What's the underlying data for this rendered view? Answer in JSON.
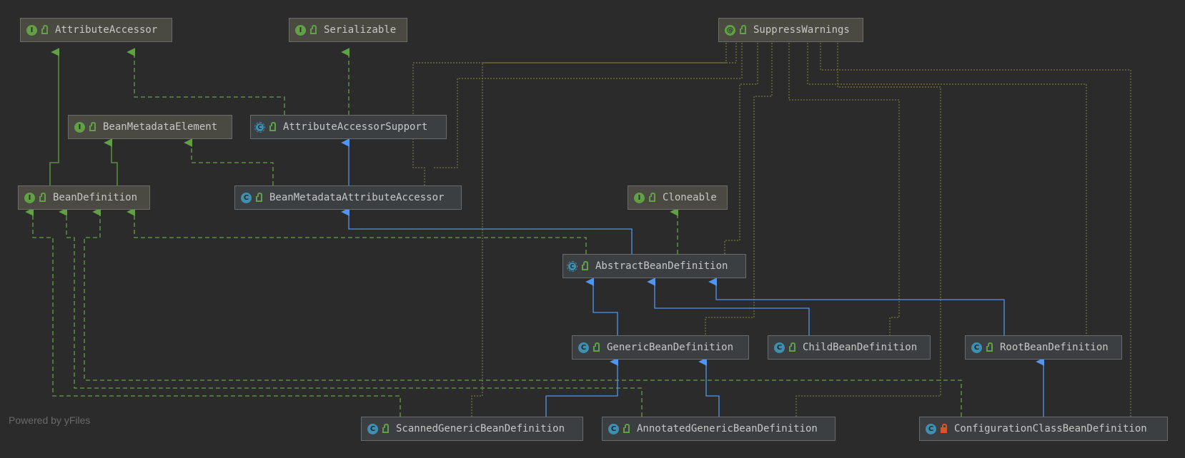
{
  "nodes": {
    "attribute_accessor": {
      "name": "AttributeAccessor",
      "kind": "interface",
      "badge": "I"
    },
    "serializable": {
      "name": "Serializable",
      "kind": "interface",
      "badge": "I"
    },
    "suppress_warnings": {
      "name": "SuppressWarnings",
      "kind": "annotation",
      "badge": "@"
    },
    "bean_metadata_element": {
      "name": "BeanMetadataElement",
      "kind": "interface",
      "badge": "I"
    },
    "attribute_accessor_support": {
      "name": "AttributeAccessorSupport",
      "kind": "abstract-class",
      "badge": "C"
    },
    "bean_definition": {
      "name": "BeanDefinition",
      "kind": "interface",
      "badge": "I"
    },
    "bean_metadata_attribute_accessor": {
      "name": "BeanMetadataAttributeAccessor",
      "kind": "class",
      "badge": "C"
    },
    "cloneable": {
      "name": "Cloneable",
      "kind": "interface",
      "badge": "I"
    },
    "abstract_bean_definition": {
      "name": "AbstractBeanDefinition",
      "kind": "abstract-class",
      "badge": "C"
    },
    "generic_bean_definition": {
      "name": "GenericBeanDefinition",
      "kind": "class",
      "badge": "C"
    },
    "child_bean_definition": {
      "name": "ChildBeanDefinition",
      "kind": "class",
      "badge": "C"
    },
    "root_bean_definition": {
      "name": "RootBeanDefinition",
      "kind": "class",
      "badge": "C"
    },
    "scanned_generic_bean_definition": {
      "name": "ScannedGenericBeanDefinition",
      "kind": "class",
      "badge": "C"
    },
    "annotated_generic_bean_definition": {
      "name": "AnnotatedGenericBeanDefinition",
      "kind": "class",
      "badge": "C"
    },
    "configuration_class_bean_definition": {
      "name": "ConfigurationClassBeanDefinition",
      "kind": "class",
      "badge": "C"
    }
  },
  "colors": {
    "background": "#2b2b2b",
    "extends": "#5394ec",
    "implements": "#62a046",
    "annotation_link": "#8a8a3a"
  },
  "watermark": "Powered by yFiles"
}
